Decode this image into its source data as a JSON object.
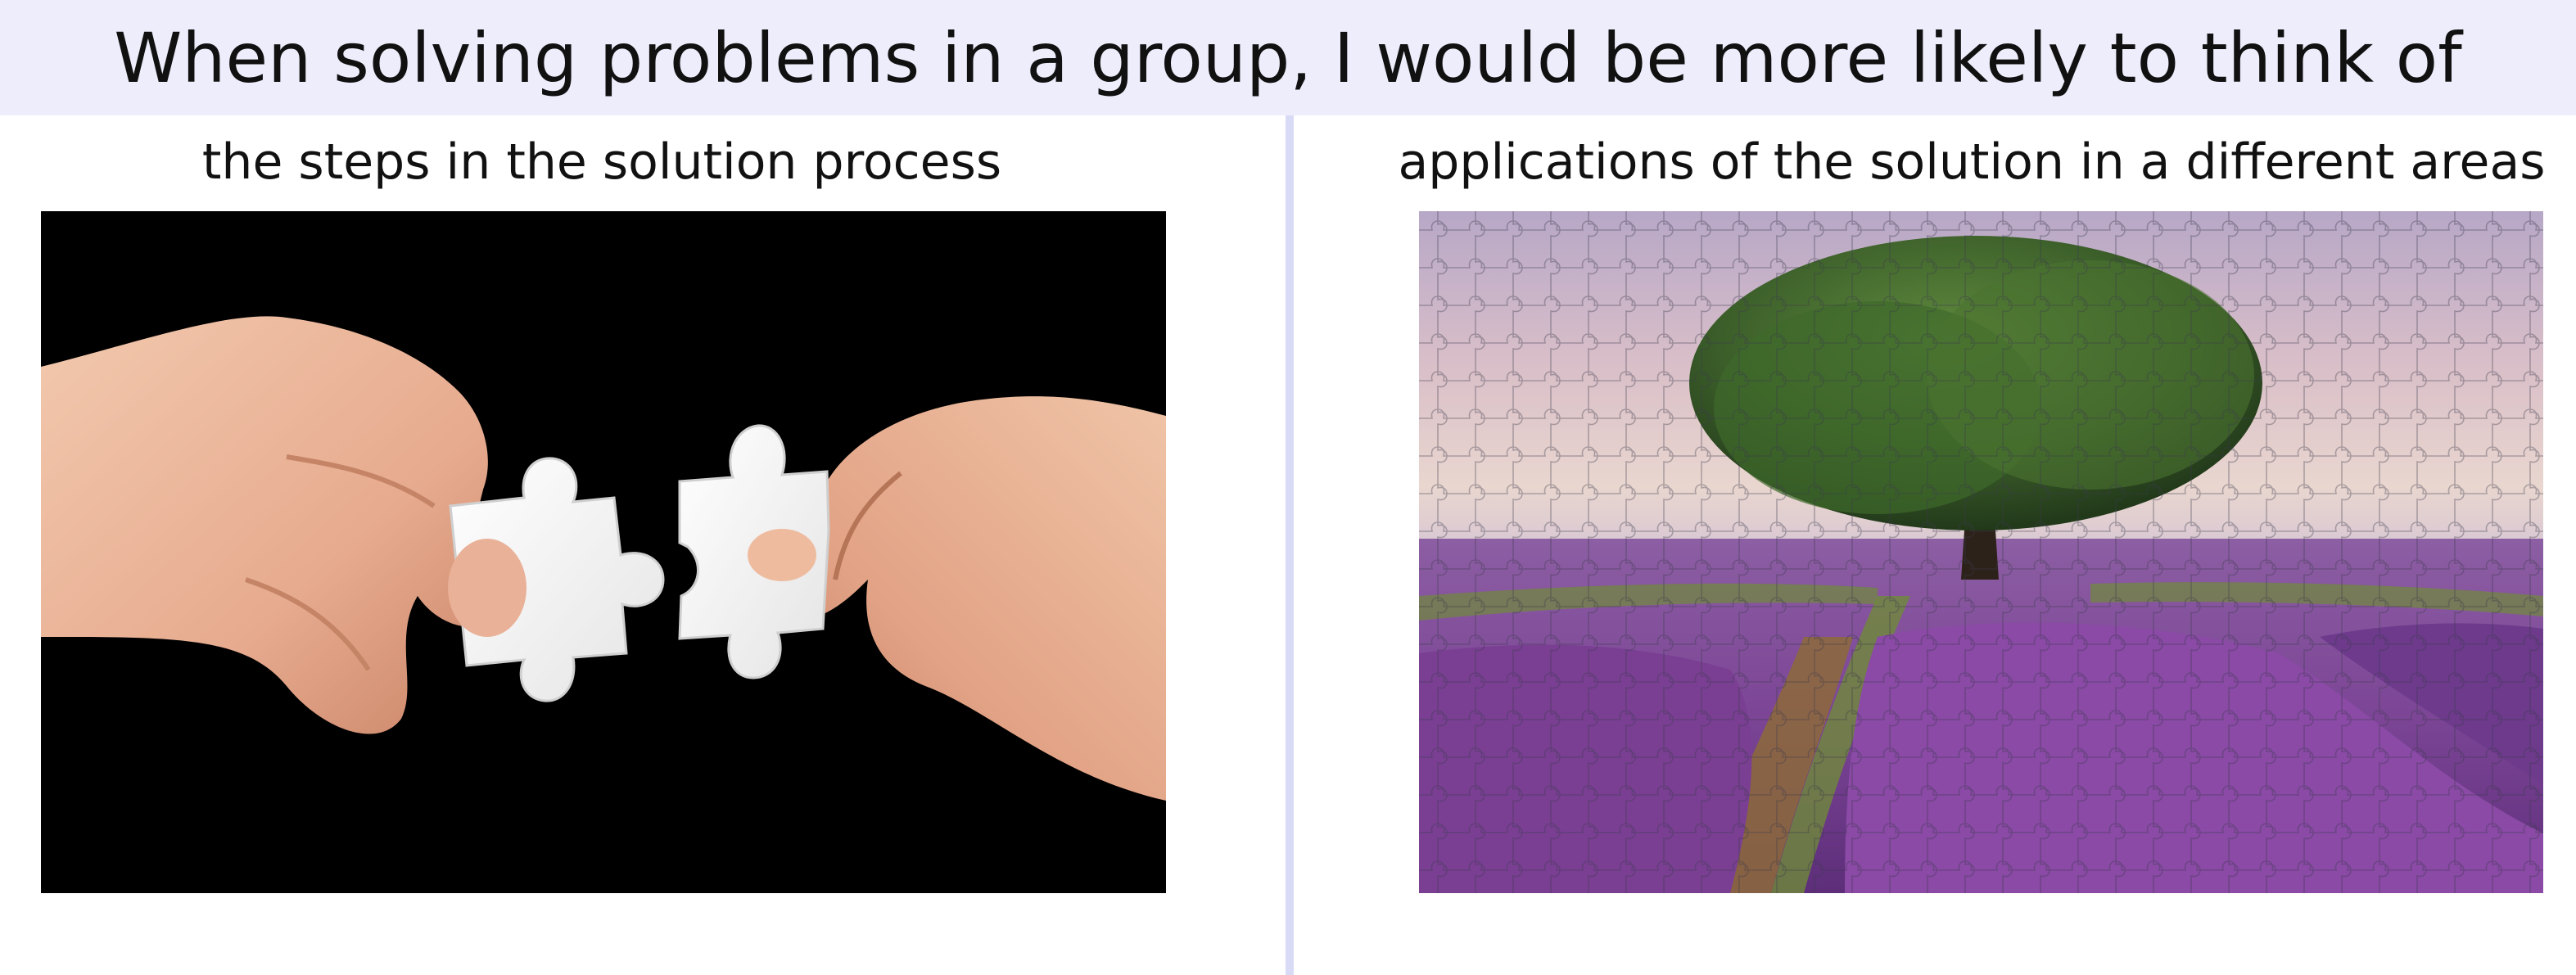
{
  "question": {
    "title": "When solving problems in a group, I would be more likely to think of"
  },
  "options": [
    {
      "label": "the steps in the solution process",
      "image_subject": "two hands holding white jigsaw puzzle pieces on black background"
    },
    {
      "label": "applications of the solution in a different areas",
      "image_subject": "jigsaw puzzle of a tree in a lavender field"
    }
  ],
  "colors": {
    "header_bg": "#ededfb",
    "divider": "#d9dbf6"
  }
}
